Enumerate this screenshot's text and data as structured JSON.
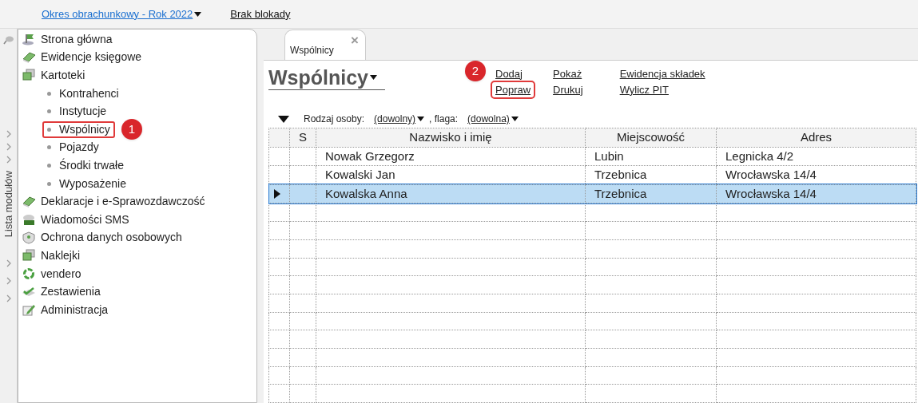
{
  "top_bar": {
    "period_link": "Okres obrachunkowy - Rok 2022",
    "lock_link": "Brak blokady"
  },
  "rail": {
    "label": "Lista modułów"
  },
  "sidebar": {
    "items": [
      {
        "label": "Strona główna"
      },
      {
        "label": "Ewidencje księgowe"
      },
      {
        "label": "Kartoteki",
        "children": [
          {
            "label": "Kontrahenci",
            "selected": false
          },
          {
            "label": "Instytucje",
            "selected": false
          },
          {
            "label": "Wspólnicy",
            "selected": true,
            "badge": "1"
          },
          {
            "label": "Pojazdy",
            "selected": false
          },
          {
            "label": "Środki trwałe",
            "selected": false
          },
          {
            "label": "Wyposażenie",
            "selected": false
          }
        ]
      },
      {
        "label": "Deklaracje i e-Sprawozdawczość"
      },
      {
        "label": "Wiadomości SMS"
      },
      {
        "label": "Ochrona danych osobowych"
      },
      {
        "label": "Naklejki"
      },
      {
        "label": "vendero"
      },
      {
        "label": "Zestawienia"
      },
      {
        "label": "Administracja"
      }
    ]
  },
  "tabs": [
    {
      "label": "Wspólnicy",
      "selected": true,
      "close": "×"
    }
  ],
  "page_title": "Wspólnicy",
  "actions": [
    {
      "label": "Dodaj",
      "highlighted": false
    },
    {
      "label": "Popraw",
      "highlighted": true,
      "badge": "2"
    },
    {
      "label": "Pokaż",
      "highlighted": false
    },
    {
      "label": "Drukuj",
      "highlighted": false
    },
    {
      "label": "Ewidencja składek",
      "highlighted": false
    },
    {
      "label": "Wylicz PIT",
      "highlighted": false
    }
  ],
  "filter": {
    "person_label": "Rodzaj osoby:",
    "person_value": "(dowolny)",
    "separator": ", flaga:",
    "flag_value": "(dowolna)"
  },
  "table": {
    "columns": [
      "S",
      "Nazwisko i imię",
      "Miejscowość",
      "Adres"
    ],
    "rows": [
      {
        "cells": [
          "",
          "Nowak Grzegorz",
          "Lubin",
          "Legnicka 4/2"
        ],
        "selected": false
      },
      {
        "cells": [
          "",
          "Kowalski Jan",
          "Trzebnica",
          "Wrocławska 14/4"
        ],
        "selected": false
      },
      {
        "cells": [
          "",
          "Kowalska Anna",
          "Trzebnica",
          "Wrocławska 14/4"
        ],
        "selected": true
      }
    ]
  }
}
